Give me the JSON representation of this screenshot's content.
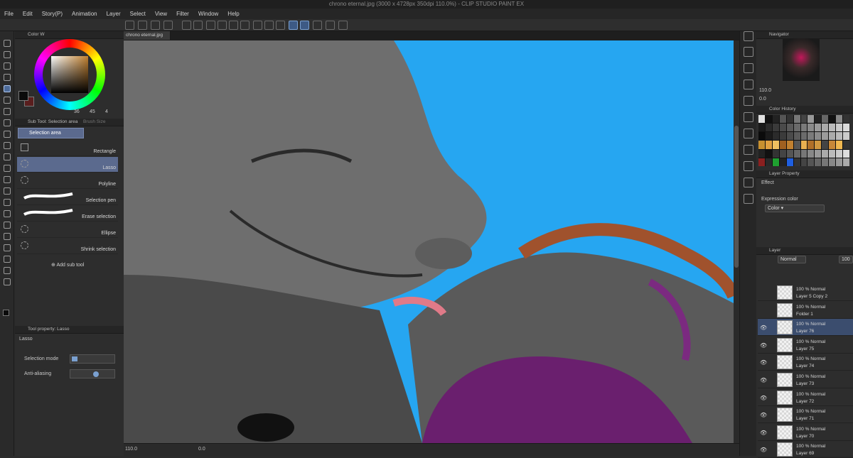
{
  "window": {
    "title": "chrono eternal.jpg (3000 x 4728px 350dpi 110.0%) - CLIP STUDIO PAINT EX"
  },
  "menu": [
    "File",
    "Edit",
    "Story(P)",
    "Animation",
    "Layer",
    "Select",
    "View",
    "Filter",
    "Window",
    "Help"
  ],
  "canvas_tab": "chrono eternal.jpg",
  "color_panel": {
    "tab": "Color W",
    "values": [
      "36",
      "45",
      "4"
    ],
    "main_color": "#0b0b0b",
    "sub_color": "#5a1e1e"
  },
  "subtool_panel": {
    "tab_active": "Sub Tool: Selection area",
    "tab_inactive": "Brush Size",
    "group_label": "Selection area",
    "items": [
      "Rectangle",
      "Lasso",
      "Polyline",
      "Selection pen",
      "Erase selection",
      "Ellipse",
      "Shrink selection"
    ],
    "add_label": "Add sub tool"
  },
  "tool_property": {
    "tab": "Tool property: Lasso",
    "tool_name": "Lasso",
    "rows": [
      "Selection mode",
      "Anti-aliasing"
    ]
  },
  "navigator": {
    "tab": "Navigator",
    "zoom": "110.0",
    "angle": "0.0"
  },
  "color_history": {
    "tab": "Color History"
  },
  "layer_property": {
    "tab": "Layer Property",
    "effect_label": "Effect",
    "expression_label": "Expression color",
    "expression_value": "Color"
  },
  "layer_panel": {
    "tab": "Layer",
    "blend": "Normal",
    "opacity": "100",
    "layers": [
      {
        "mode": "100 % Normal",
        "name": "Layer 5 Copy 2"
      },
      {
        "mode": "100 % Normal",
        "name": "Folder 1"
      },
      {
        "mode": "100 % Normal",
        "name": "Layer 76"
      },
      {
        "mode": "100 % Normal",
        "name": "Layer 75"
      },
      {
        "mode": "100 % Normal",
        "name": "Layer 74"
      },
      {
        "mode": "100 % Normal",
        "name": "Layer 73"
      },
      {
        "mode": "100 % Normal",
        "name": "Layer 72"
      },
      {
        "mode": "100 % Normal",
        "name": "Layer 71"
      },
      {
        "mode": "100 % Normal",
        "name": "Layer 70"
      },
      {
        "mode": "100 % Normal",
        "name": "Layer 69"
      }
    ]
  },
  "status": {
    "zoom": "110.0",
    "angle": "0.0"
  },
  "colors": {
    "canvas_bg": "#26a6f1",
    "accent": "#5b6a8e",
    "selected_layer": "#3b4d6e"
  }
}
